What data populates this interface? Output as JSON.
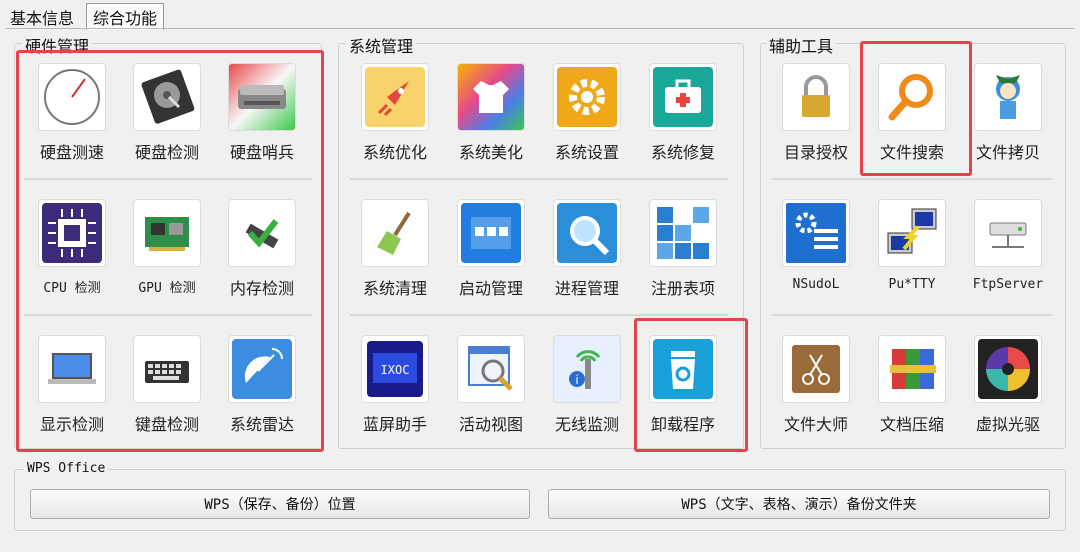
{
  "tabs": [
    "基本信息",
    "综合功能"
  ],
  "groups": {
    "hardware": {
      "title": "硬件管理",
      "items": [
        {
          "label": "硬盘测速",
          "icon": "gauge-icon"
        },
        {
          "label": "硬盘检测",
          "icon": "hard-disk-icon"
        },
        {
          "label": "硬盘哨兵",
          "icon": "disk-sentinel-icon"
        },
        {
          "label": "CPU 检测",
          "icon": "cpu-chip-icon"
        },
        {
          "label": "GPU 检测",
          "icon": "gpu-card-icon"
        },
        {
          "label": "内存检测",
          "icon": "memory-check-icon"
        },
        {
          "label": "显示检测",
          "icon": "monitor-laptop-icon"
        },
        {
          "label": "键盘检测",
          "icon": "keyboard-icon"
        },
        {
          "label": "系统雷达",
          "icon": "satellite-dish-icon"
        }
      ]
    },
    "system": {
      "title": "系统管理",
      "items": [
        {
          "label": "系统优化",
          "icon": "rocket-icon"
        },
        {
          "label": "系统美化",
          "icon": "tshirt-icon"
        },
        {
          "label": "系统设置",
          "icon": "gear-icon"
        },
        {
          "label": "系统修复",
          "icon": "first-aid-kit-icon"
        },
        {
          "label": "系统清理",
          "icon": "broom-icon"
        },
        {
          "label": "启动管理",
          "icon": "startup-window-icon"
        },
        {
          "label": "进程管理",
          "icon": "process-magnifier-icon"
        },
        {
          "label": "注册表项",
          "icon": "registry-blocks-icon"
        },
        {
          "label": "蓝屏助手",
          "icon": "bluescreen-icon"
        },
        {
          "label": "活动视图",
          "icon": "activity-view-icon"
        },
        {
          "label": "无线监测",
          "icon": "wireless-info-icon"
        },
        {
          "label": "卸载程序",
          "icon": "recycle-bin-icon"
        }
      ]
    },
    "tools": {
      "title": "辅助工具",
      "items": [
        {
          "label": "目录授权",
          "icon": "padlock-icon"
        },
        {
          "label": "文件搜索",
          "icon": "search-icon"
        },
        {
          "label": "文件拷贝",
          "icon": "anime-mascot-icon"
        },
        {
          "label": "NSudoL",
          "icon": "admin-gear-icon"
        },
        {
          "label": "Pu*TTY",
          "icon": "putty-terminal-icon"
        },
        {
          "label": "FtpServer",
          "icon": "ftp-server-icon"
        },
        {
          "label": "文件大师",
          "icon": "archive-scissors-icon"
        },
        {
          "label": "文档压缩",
          "icon": "compressed-books-icon"
        },
        {
          "label": "虚拟光驱",
          "icon": "optical-disc-icon"
        }
      ]
    }
  },
  "wps": {
    "title": "WPS Office",
    "button1": "WPS（保存、备份）位置",
    "button2": "WPS（文字、表格、演示）备份文件夹"
  },
  "colors": {
    "highlight": "#e5434a",
    "background": "#f0f0f0"
  }
}
